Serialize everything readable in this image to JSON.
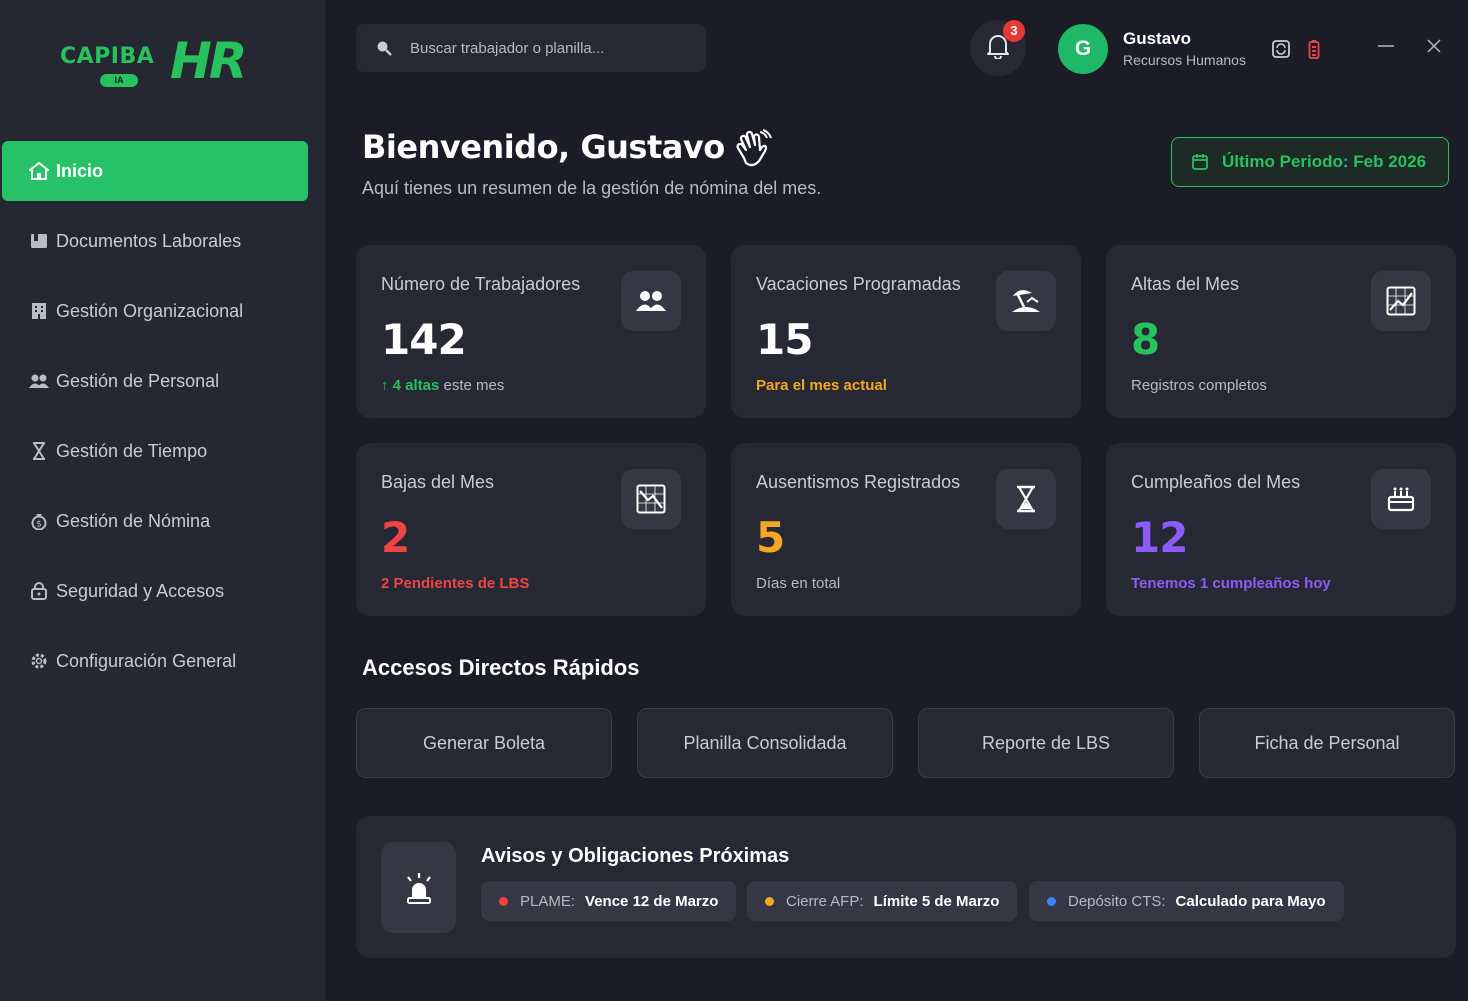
{
  "brand": {
    "name": "CAPIBA",
    "tag": "IA",
    "mark": "HR",
    "color": "#27c25e"
  },
  "sidebar": {
    "items": [
      {
        "label": "Inicio",
        "icon": "home-icon",
        "active": true
      },
      {
        "label": "Documentos Laborales",
        "icon": "document-icon"
      },
      {
        "label": "Gestión Organizacional",
        "icon": "building-icon"
      },
      {
        "label": "Gestión de Personal",
        "icon": "users-icon"
      },
      {
        "label": "Gestión de Tiempo",
        "icon": "hourglass-icon"
      },
      {
        "label": "Gestión de Nómina",
        "icon": "money-bag-icon"
      },
      {
        "label": "Seguridad y Accesos",
        "icon": "lock-icon"
      },
      {
        "label": "Configuración General",
        "icon": "gear-icon"
      }
    ]
  },
  "topbar": {
    "search_placeholder": "Buscar trabajador o planilla...",
    "notifications_count": "3",
    "user": {
      "initial": "G",
      "name": "Gustavo",
      "role": "Recursos Humanos"
    }
  },
  "header": {
    "welcome": "Bienvenido, Gustavo",
    "subtitle": "Aquí tienes un resumen de la gestión de nómina del mes.",
    "period": "Último Periodo: Feb 2026"
  },
  "cards": [
    {
      "title": "Número de Trabajadores",
      "value": "142",
      "sub_strong": "↑ 4 altas",
      "sub_rest": " este mes",
      "value_color": "#ffffff",
      "sub_color": "#27c25e",
      "icon": "users-icon"
    },
    {
      "title": "Vacaciones Programadas",
      "value": "15",
      "sub_strong": "Para el mes actual",
      "sub_rest": "",
      "value_color": "#ffffff",
      "sub_color": "#f5a623",
      "icon": "beach-icon"
    },
    {
      "title": "Altas del Mes",
      "value": "8",
      "sub_strong": "",
      "sub_rest": "Registros completos",
      "value_color": "#27c25e",
      "sub_color": "#b7b9c4",
      "icon": "chart-up-icon"
    },
    {
      "title": "Bajas del Mes",
      "value": "2",
      "sub_strong": "2 Pendientes de LBS",
      "sub_rest": "",
      "value_color": "#ef4444",
      "sub_color": "#ef4444",
      "icon": "chart-down-icon"
    },
    {
      "title": "Ausentismos Registrados",
      "value": "5",
      "sub_strong": "",
      "sub_rest": "Días en total",
      "value_color": "#f5a623",
      "sub_color": "#b7b9c4",
      "icon": "hourglass-icon"
    },
    {
      "title": "Cumpleaños del Mes",
      "value": "12",
      "sub_strong": "Tenemos 1 cumpleaños hoy",
      "sub_rest": "",
      "value_color": "#8b5cf6",
      "sub_color": "#8b5cf6",
      "icon": "cake-icon"
    }
  ],
  "quick_access": {
    "title": "Accesos Directos Rápidos",
    "buttons": [
      "Generar Boleta",
      "Planilla Consolidada",
      "Reporte de LBS",
      "Ficha de Personal"
    ]
  },
  "notices": {
    "title": "Avisos y Obligaciones Próximas",
    "items": [
      {
        "label": "PLAME:",
        "value": "Vence 12 de Marzo",
        "color": "#ef4444"
      },
      {
        "label": "Cierre AFP:",
        "value": "Límite 5 de Marzo",
        "color": "#f5a623"
      },
      {
        "label": "Depósito CTS:",
        "value": "Calculado para Mayo",
        "color": "#3b82f6"
      }
    ]
  }
}
